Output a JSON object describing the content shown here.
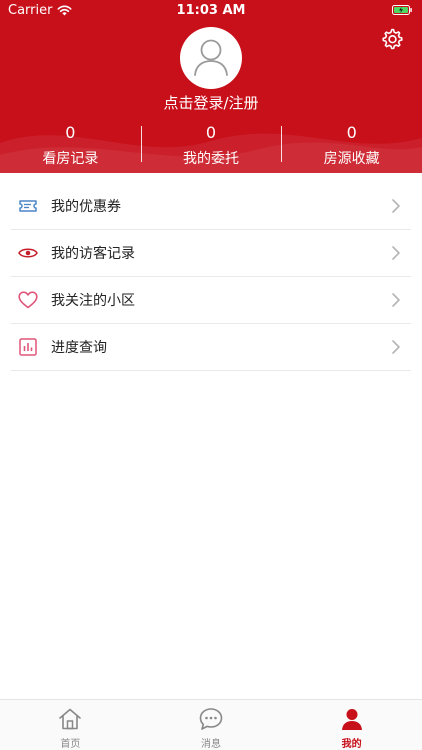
{
  "status_bar": {
    "carrier": "Carrier",
    "time": "11:03 AM"
  },
  "header": {
    "login_text": "点击登录/注册"
  },
  "stats": [
    {
      "value": "0",
      "label": "看房记录"
    },
    {
      "value": "0",
      "label": "我的委托"
    },
    {
      "value": "0",
      "label": "房源收藏"
    }
  ],
  "menu": [
    {
      "label": "我的优惠券",
      "icon": "ticket-icon"
    },
    {
      "label": "我的访客记录",
      "icon": "eye-icon"
    },
    {
      "label": "我关注的小区",
      "icon": "heart-icon"
    },
    {
      "label": "进度查询",
      "icon": "bar-chart-icon"
    }
  ],
  "tabbar": {
    "tabs": [
      {
        "label": "首页",
        "icon": "home-icon",
        "active": false
      },
      {
        "label": "消息",
        "icon": "chat-bubble-icon",
        "active": false
      },
      {
        "label": "我的",
        "icon": "user-icon",
        "active": true
      }
    ]
  },
  "colors": {
    "brand_red": "#c8101b",
    "menu_icon_blue": "#4a86c5",
    "menu_icon_red": "#c41e2a",
    "menu_icon_pink": "#e0567a",
    "inactive_gray": "#888888"
  }
}
